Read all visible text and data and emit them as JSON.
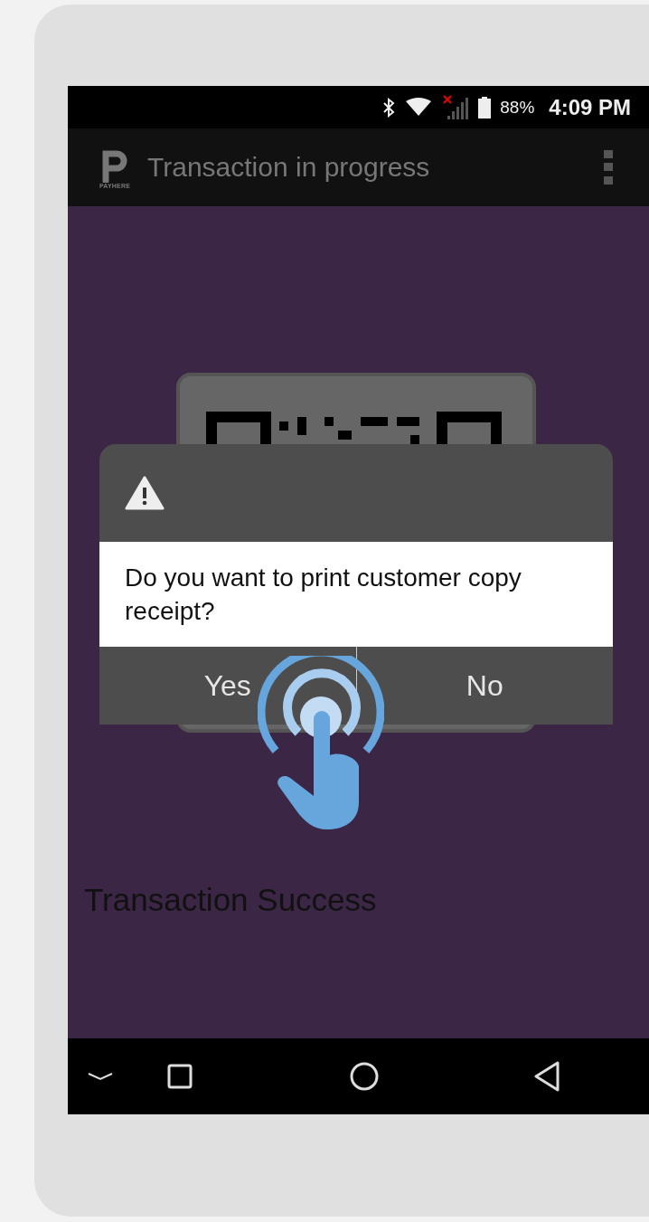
{
  "status_bar": {
    "battery": "88%",
    "time": "4:09 PM"
  },
  "app_bar": {
    "logo_text": "PAYHERE",
    "title": "Transaction in progress"
  },
  "dialog": {
    "message": "Do you want to print customer copy receipt?",
    "buttons": [
      "Yes",
      "No"
    ]
  },
  "status_message": "Transaction Success"
}
